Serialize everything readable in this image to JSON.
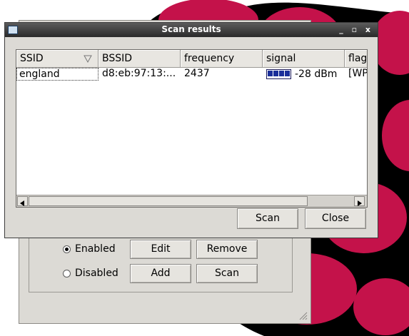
{
  "colors": {
    "raspberry": "#c4124a",
    "leaf": "#000000"
  },
  "background_window": {
    "radio_enabled_label": "Enabled",
    "radio_disabled_label": "Disabled",
    "edit_label": "Edit",
    "remove_label": "Remove",
    "add_label": "Add",
    "scan_label": "Scan",
    "selected_radio": "Enabled"
  },
  "dialog": {
    "title": "Scan results",
    "window_controls": "_ ▫ x",
    "columns": [
      "SSID",
      "BSSID",
      "frequency",
      "signal",
      "flag"
    ],
    "rows": [
      {
        "ssid": "england",
        "bssid": "d8:eb:97:13:...",
        "frequency": "2437",
        "signal_text": "-28 dBm",
        "signal_bars": 4,
        "flags": "[WP"
      }
    ],
    "scan_label": "Scan",
    "close_label": "Close"
  },
  "icons": {
    "sort": "triangle-down-icon",
    "scroll_left": "left-arrow-icon",
    "scroll_right": "right-arrow-icon"
  }
}
